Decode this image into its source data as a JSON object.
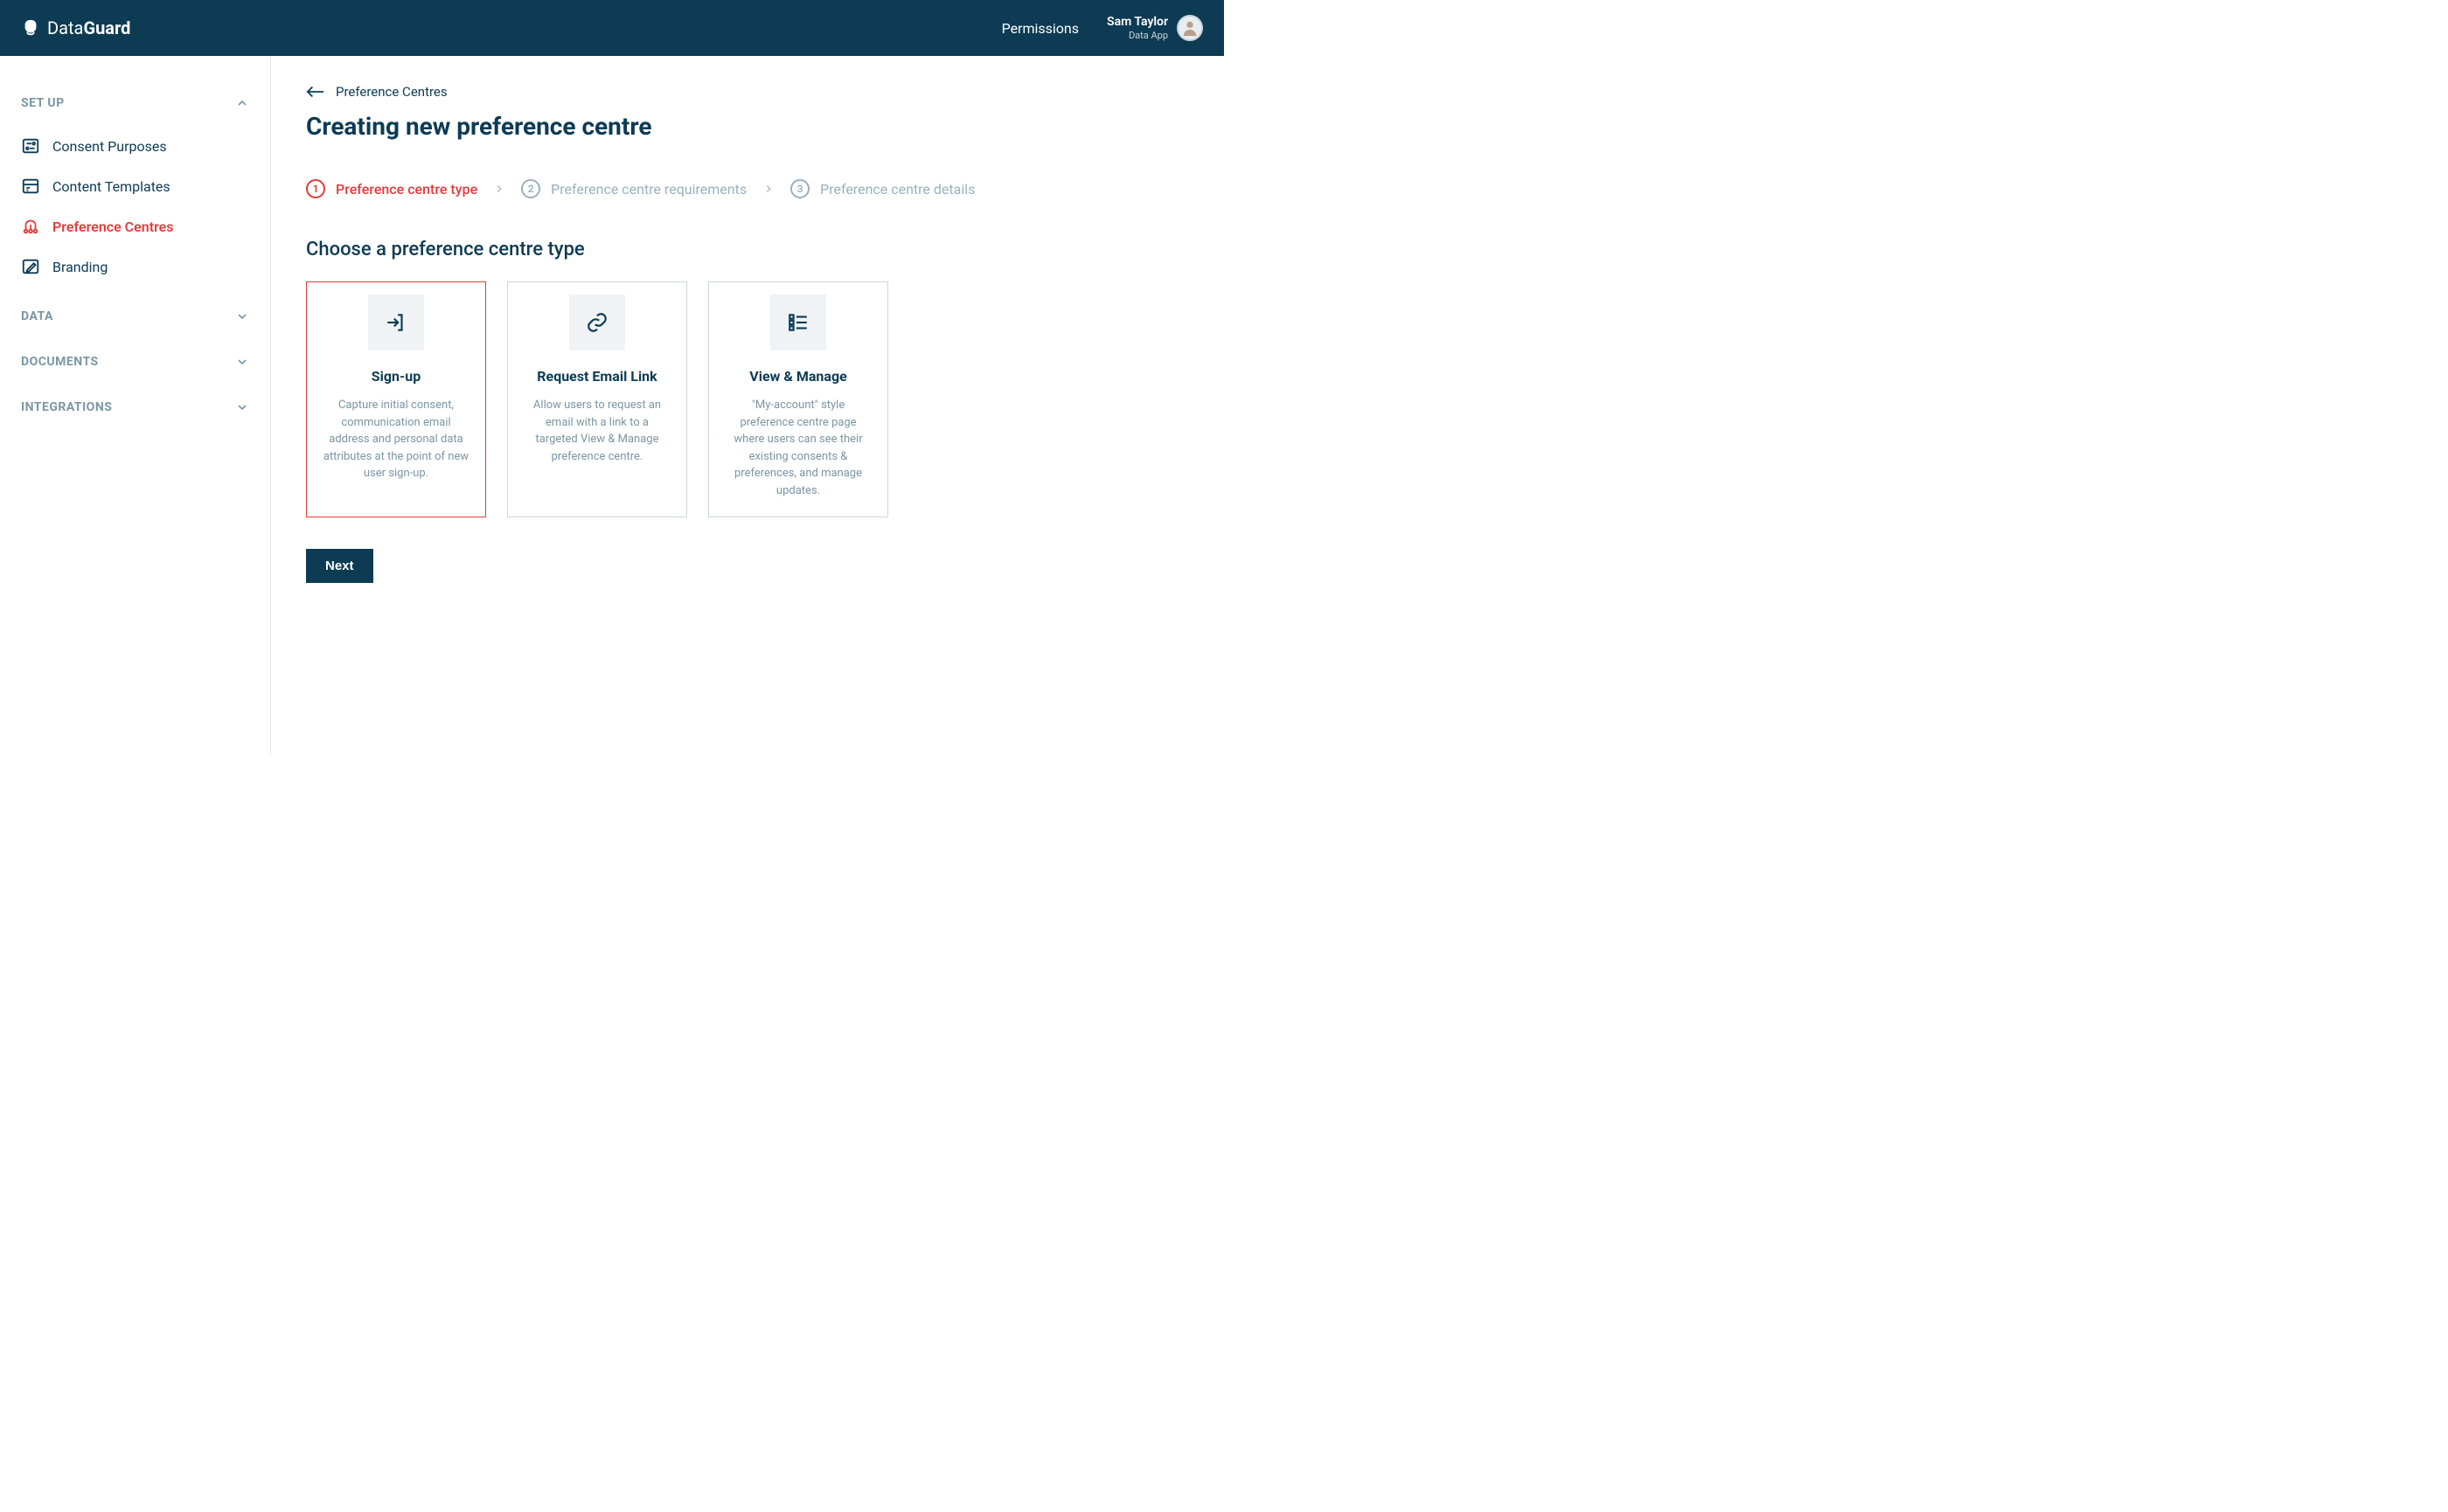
{
  "header": {
    "brand_prefix": "Data",
    "brand_suffix": "Guard",
    "permissions_link": "Permissions",
    "user_name": "Sam Taylor",
    "user_app": "Data App"
  },
  "sidebar": {
    "sections": [
      {
        "label": "SET UP",
        "expanded": true,
        "items": [
          {
            "label": "Consent Purposes",
            "active": false
          },
          {
            "label": "Content Templates",
            "active": false
          },
          {
            "label": "Preference Centres",
            "active": true
          },
          {
            "label": "Branding",
            "active": false
          }
        ]
      },
      {
        "label": "DATA",
        "expanded": false
      },
      {
        "label": "DOCUMENTS",
        "expanded": false
      },
      {
        "label": "INTEGRATIONS",
        "expanded": false
      }
    ]
  },
  "breadcrumb": {
    "back_label": "Preference Centres"
  },
  "page": {
    "title": "Creating new preference centre"
  },
  "stepper": {
    "steps": [
      {
        "num": "1",
        "label": "Preference centre type",
        "active": true
      },
      {
        "num": "2",
        "label": "Preference centre requirements",
        "active": false
      },
      {
        "num": "3",
        "label": "Preference centre details",
        "active": false
      }
    ]
  },
  "selection": {
    "heading": "Choose a preference centre type",
    "cards": [
      {
        "title": "Sign-up",
        "desc": "Capture initial consent, communication email address and personal data attributes at the point of new user sign-up.",
        "selected": true
      },
      {
        "title": "Request Email Link",
        "desc": "Allow users to request an email with a link to a targeted View & Manage preference centre.",
        "selected": false
      },
      {
        "title": "View & Manage",
        "desc": "\"My-account\" style preference centre page where users can see their existing consents & preferences, and manage updates.",
        "selected": false
      }
    ]
  },
  "actions": {
    "next_label": "Next"
  }
}
